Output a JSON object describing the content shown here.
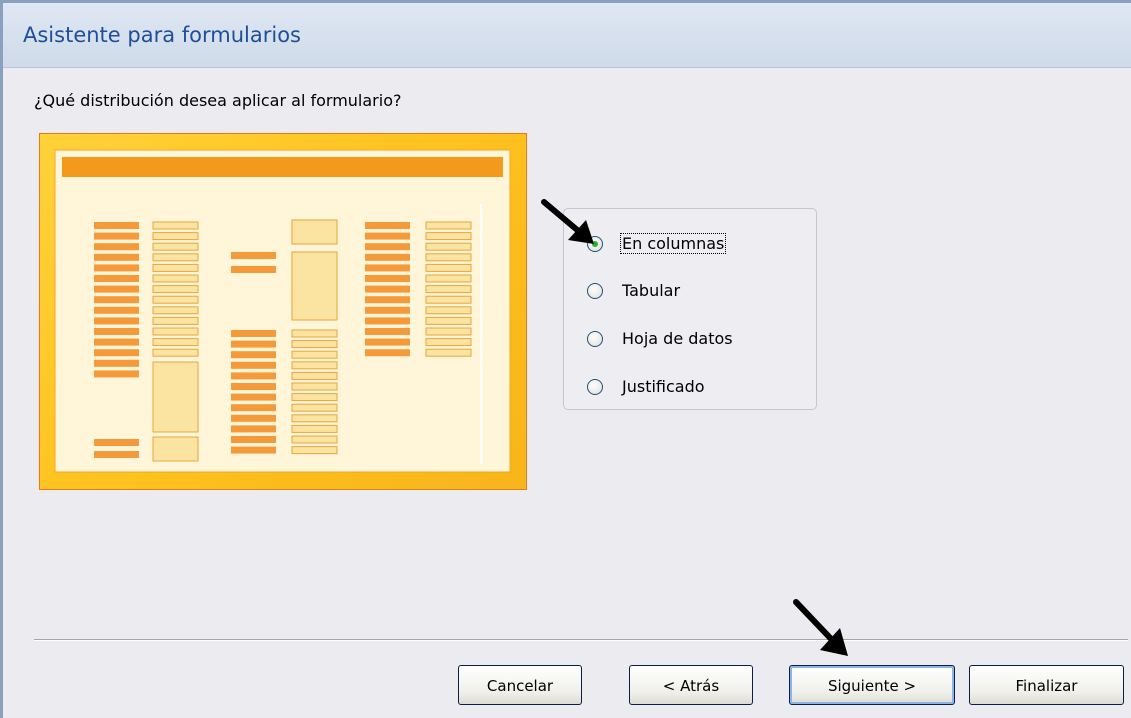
{
  "window": {
    "title": "Asistente para formularios"
  },
  "question": "¿Qué distribución desea aplicar al formulario?",
  "layout_options": [
    {
      "label": "En columnas",
      "selected": true,
      "focused": true
    },
    {
      "label": "Tabular",
      "selected": false,
      "focused": false
    },
    {
      "label": "Hoja de datos",
      "selected": false,
      "focused": false
    },
    {
      "label": "Justificado",
      "selected": false,
      "focused": false
    }
  ],
  "buttons": {
    "cancel": "Cancelar",
    "back": "< Atrás",
    "next": "Siguiente >",
    "finish": "Finalizar"
  },
  "colors": {
    "title_text": "#1f4f99",
    "preview_frame": "#ffc21e",
    "preview_field": "#f59a3a",
    "preview_box": "#fbe3a2",
    "radio_selected": "#2fb02f"
  },
  "icons": [
    "pointer-arrow-icon",
    "pointer-arrow-icon"
  ]
}
